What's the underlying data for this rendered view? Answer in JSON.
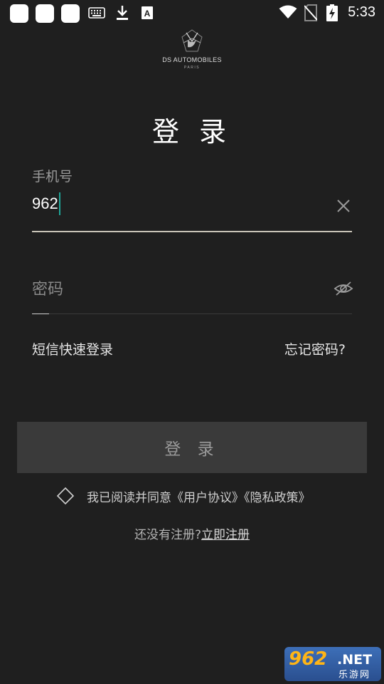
{
  "status_bar": {
    "time": "5:33",
    "icons": [
      "app-square-icon",
      "app-square-icon",
      "app-square-icon",
      "keyboard-icon",
      "download-icon",
      "font-icon",
      "wifi-icon",
      "no-sim-icon",
      "battery-charging-icon"
    ]
  },
  "brand": {
    "name": "DS AUTOMOBILES",
    "sub": "PARIS"
  },
  "page_title": "登 录",
  "phone": {
    "label": "手机号",
    "value": "962"
  },
  "password": {
    "placeholder": "密码"
  },
  "links": {
    "sms_login": "短信快速登录",
    "forgot": "忘记密码?"
  },
  "login_button": "登 录",
  "agreement": {
    "text": "我已阅读并同意《用户协议》《隐私政策》"
  },
  "register": {
    "prompt": "还没有注册?",
    "link": "立即注册"
  },
  "watermark": {
    "num": "962",
    "net": ".NET",
    "cn": "乐游网"
  },
  "colors": {
    "background": "#1f1f1f",
    "cursor": "#1fa598",
    "button": "#3a3a3a"
  }
}
